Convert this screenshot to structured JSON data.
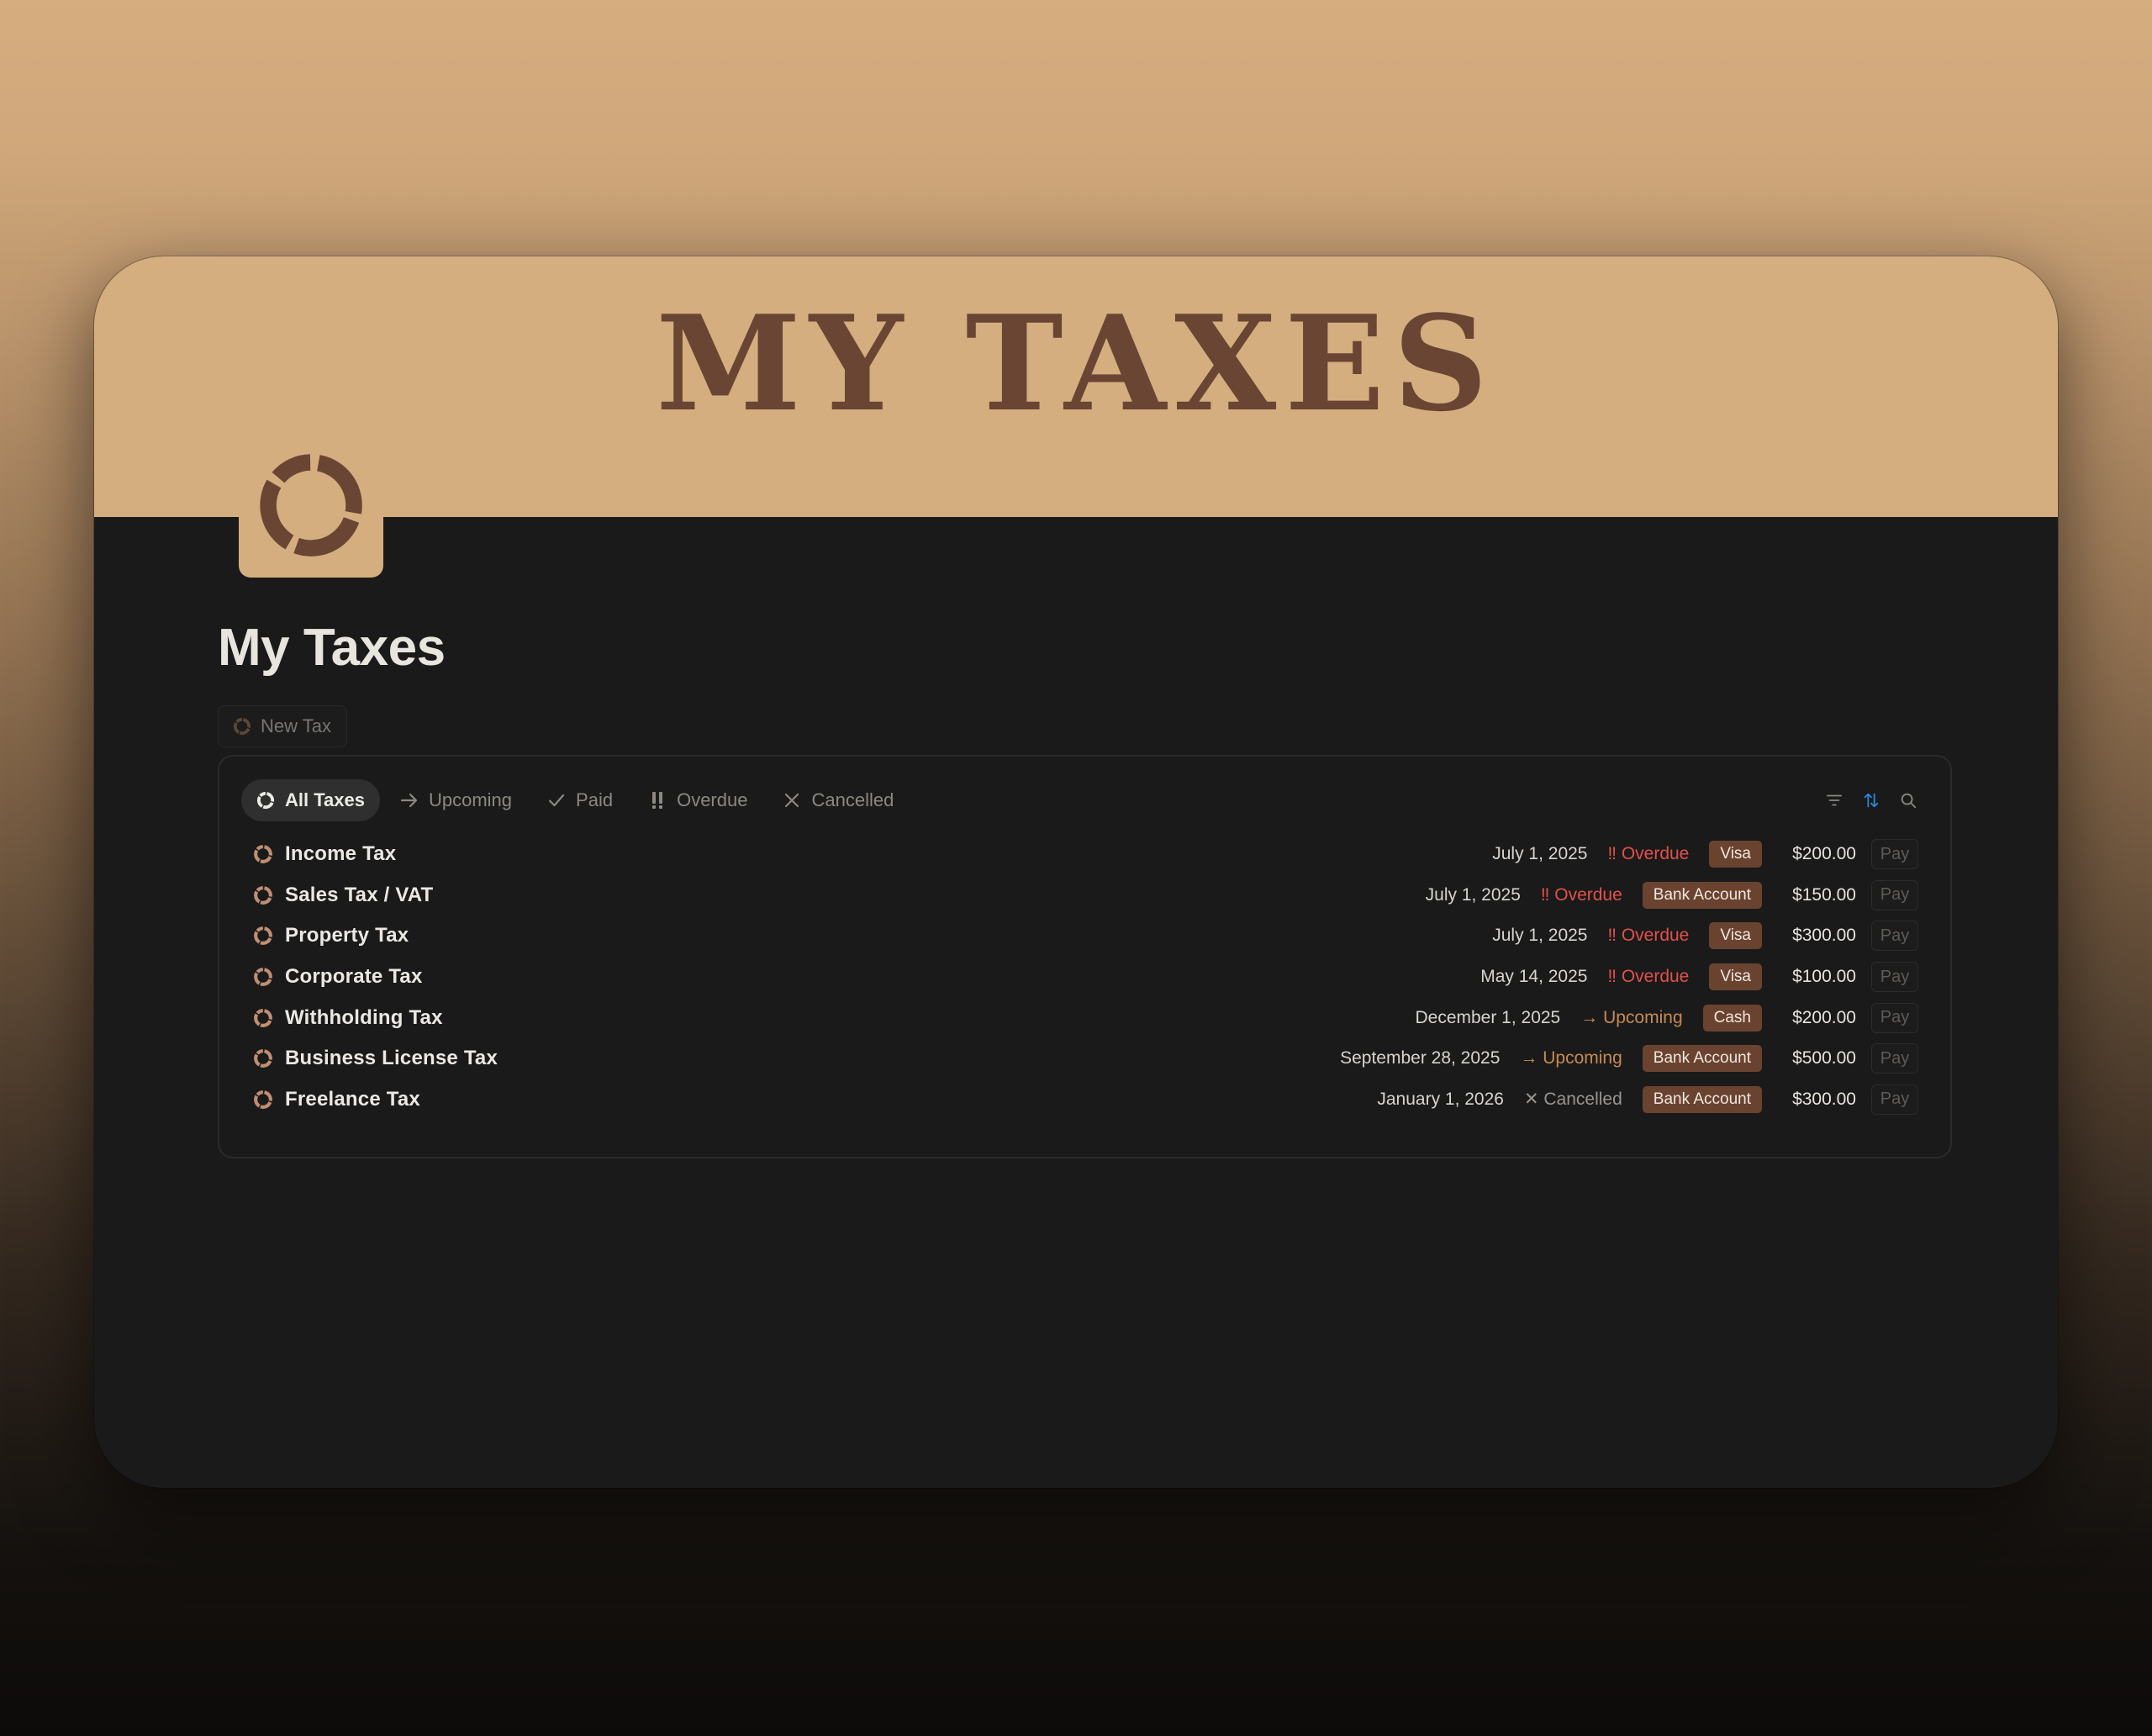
{
  "cover": {
    "title": "MY TAXES"
  },
  "page": {
    "title": "My Taxes"
  },
  "new_button": {
    "label": "New Tax"
  },
  "tabs": [
    {
      "label": "All Taxes",
      "icon": "tax-logo-icon",
      "active": true
    },
    {
      "label": "Upcoming",
      "icon": "arrow-right-icon"
    },
    {
      "label": "Paid",
      "icon": "check-icon"
    },
    {
      "label": "Overdue",
      "icon": "double-exclamation-icon"
    },
    {
      "label": "Cancelled",
      "icon": "x-icon"
    }
  ],
  "toolbar": {
    "icons": [
      "filter-icon",
      "sort-icon",
      "search-icon"
    ]
  },
  "rows": [
    {
      "name": "Income Tax",
      "date": "July 1, 2025",
      "status": "‼ Overdue",
      "status_type": "overdue",
      "method": "Visa",
      "amount": "$200.00",
      "action": "Pay"
    },
    {
      "name": "Sales Tax / VAT",
      "date": "July 1, 2025",
      "status": "‼ Overdue",
      "status_type": "overdue",
      "method": "Bank Account",
      "amount": "$150.00",
      "action": "Pay"
    },
    {
      "name": "Property Tax",
      "date": "July 1, 2025",
      "status": "‼ Overdue",
      "status_type": "overdue",
      "method": "Visa",
      "amount": "$300.00",
      "action": "Pay"
    },
    {
      "name": "Corporate Tax",
      "date": "May 14, 2025",
      "status": "‼ Overdue",
      "status_type": "overdue",
      "method": "Visa",
      "amount": "$100.00",
      "action": "Pay"
    },
    {
      "name": "Withholding Tax",
      "date": "December 1, 2025",
      "status": "→ Upcoming",
      "status_type": "upcoming",
      "method": "Cash",
      "amount": "$200.00",
      "action": "Pay"
    },
    {
      "name": "Business License Tax",
      "date": "September 28, 2025",
      "status": "→ Upcoming",
      "status_type": "upcoming",
      "method": "Bank Account",
      "amount": "$500.00",
      "action": "Pay"
    },
    {
      "name": "Freelance Tax",
      "date": "January 1, 2026",
      "status": "✕ Cancelled",
      "status_type": "cancelled",
      "method": "Bank Account",
      "amount": "$300.00",
      "action": "Pay"
    }
  ],
  "colors": {
    "cover_bg": "#d5ae80",
    "brand_brown": "#6a4533",
    "overdue": "#e2514c",
    "upcoming": "#c88a52",
    "tag_bg": "#6a4330",
    "page_bg": "#1a1a1a"
  }
}
